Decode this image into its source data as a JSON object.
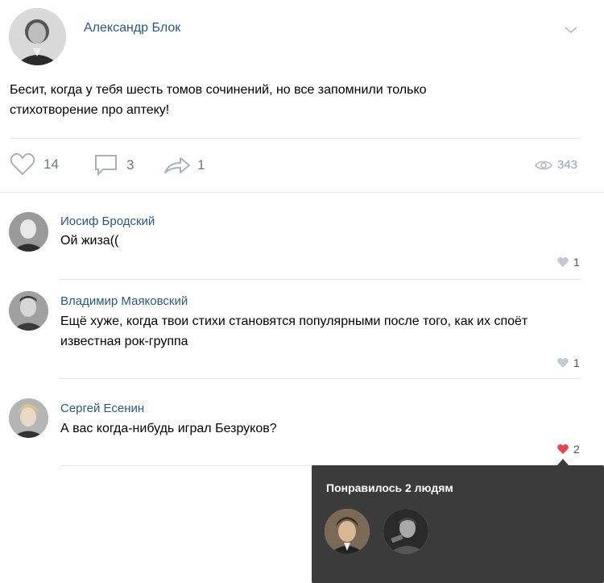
{
  "post": {
    "author": "Александр Блок",
    "text": "Бесит, когда у тебя шесть томов сочинений, но все запомнили только стихотворение про аптеку!",
    "likes": "14",
    "comments": "3",
    "shares": "1",
    "views": "343",
    "icons": {
      "menu": "chevron-down-icon",
      "like": "heart-icon",
      "comment": "comment-icon",
      "share": "share-arrow-icon",
      "views": "eye-icon"
    }
  },
  "comments": [
    {
      "author": "Иосиф Бродский",
      "text": "Ой жиза((",
      "likes": "1",
      "liked": false
    },
    {
      "author": "Владимир Маяковский",
      "text": "Ещё хуже, когда твои стихи становятся популярными после того, как их споёт известная рок-группа",
      "likes": "1",
      "liked": false
    },
    {
      "author": "Сергей Есенин",
      "text": "А вас когда-нибудь играл Безруков?",
      "likes": "2",
      "liked": true
    }
  ],
  "tooltip": {
    "title": "Понравилось 2 людям",
    "avatars": 2
  },
  "colors": {
    "link": "#2a5885",
    "liked_heart": "#e64646",
    "tooltip_bg": "#3b3b3b"
  }
}
